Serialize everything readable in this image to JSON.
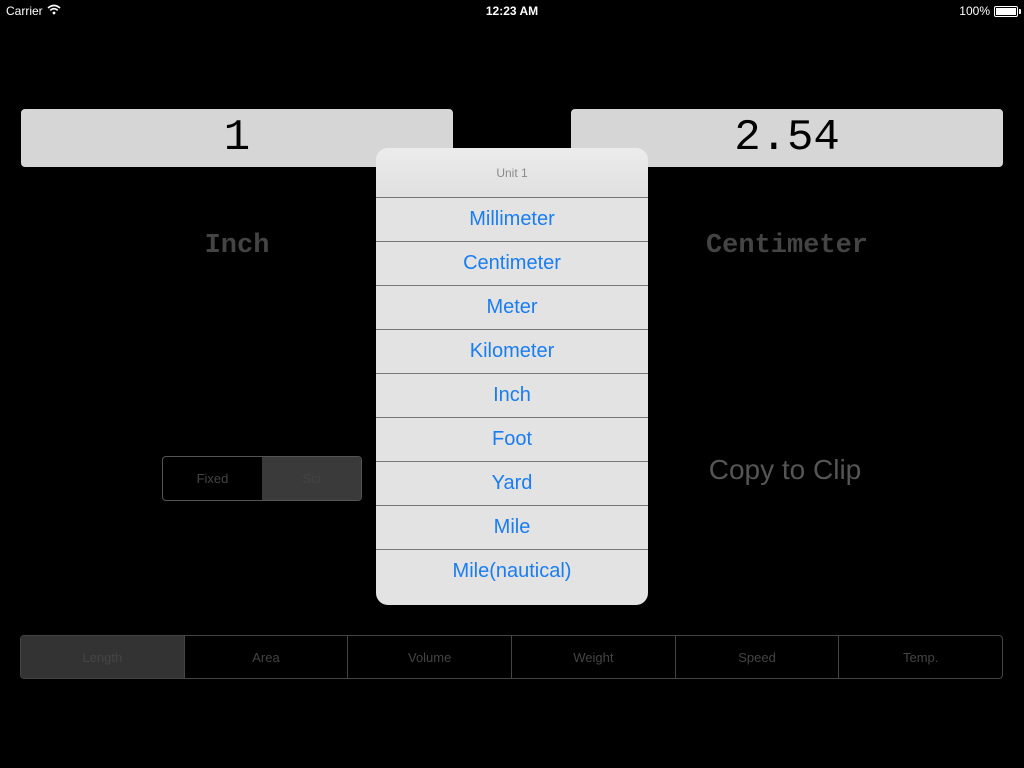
{
  "status_bar": {
    "carrier": "Carrier",
    "time": "12:23 AM",
    "battery": "100%"
  },
  "converter": {
    "input_value": "1",
    "output_value": "2.54",
    "unit_from": "Inch",
    "unit_to": "Centimeter",
    "copy_label": "Copy to Clip"
  },
  "format_segment": {
    "options": [
      "Fixed",
      "Sci"
    ],
    "selected": "Sci"
  },
  "categories": {
    "options": [
      "Length",
      "Area",
      "Volume",
      "Weight",
      "Speed",
      "Temp."
    ],
    "selected": "Length"
  },
  "unit_popover": {
    "title": "Unit 1",
    "items": [
      "Millimeter",
      "Centimeter",
      "Meter",
      "Kilometer",
      "Inch",
      "Foot",
      "Yard",
      "Mile",
      "Mile(nautical)"
    ]
  },
  "colors": {
    "accent": "#1a7df0",
    "background": "#000000"
  }
}
